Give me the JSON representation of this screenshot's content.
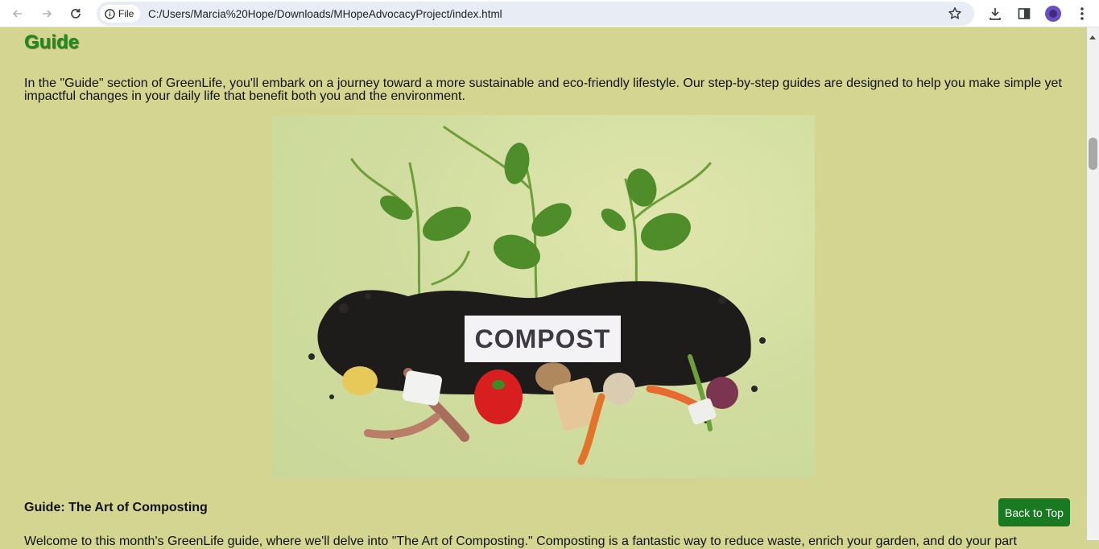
{
  "browser": {
    "site_label": "File",
    "url": "C:/Users/Marcia%20Hope/Downloads/MHopeAdvocacyProject/index.html",
    "icons": [
      "back-arrow-icon",
      "forward-arrow-icon",
      "reload-icon",
      "info-icon",
      "star-icon",
      "download-icon",
      "side-panel-icon",
      "profile-avatar-icon",
      "menu-kebab-icon"
    ]
  },
  "page": {
    "section_heading": "Guide",
    "intro": "In the \"Guide\" section of GreenLife, you'll embark on a journey toward a more sustainable and eco-friendly lifestyle. Our step-by-step guides are designed to help you make simple yet impactful changes in your daily life that benefit both you and the environment.",
    "hero_label": "COMPOST",
    "guide_title": "Guide: The Art of Composting",
    "cut_line": "Welcome to this month's GreenLife guide, where we'll delve into \"The Art of Composting.\" Composting is a fantastic way to reduce waste, enrich your garden, and do your part",
    "back_to_top": "Back to Top"
  },
  "colors": {
    "page_bg": "#d4d590",
    "heading": "#1f8a1f",
    "button_bg": "#1a7a22"
  }
}
